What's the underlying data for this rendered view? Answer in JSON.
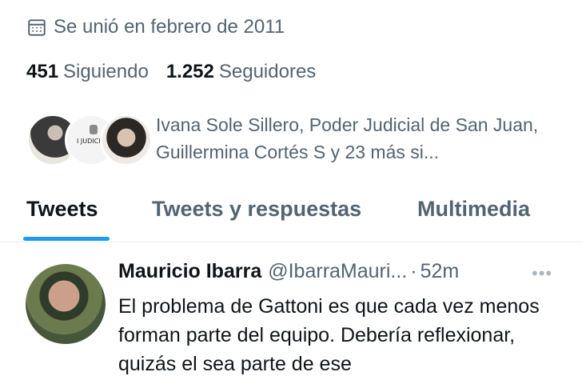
{
  "profile": {
    "joined_text": "Se unió en febrero de 2011",
    "following_count": "451",
    "following_label": "Siguiendo",
    "followers_count": "1.252",
    "followers_label": "Seguidores",
    "followed_by_text": "Ivana Sole Sillero, Poder Judicial de San Juan, Guillermina Cortés S y 23 más si...",
    "followed_avatar_2_text": "I JUDICIAL"
  },
  "tabs": [
    {
      "label": "Tweets",
      "active": true
    },
    {
      "label": "Tweets y respuestas",
      "active": false
    },
    {
      "label": "Multimedia",
      "active": false
    }
  ],
  "tweet": {
    "name": "Mauricio Ibarra",
    "handle": "@IbarraMauri...",
    "separator": "·",
    "time": "52m",
    "more_icon": "more-horizontal-icon",
    "text": "El problema de Gattoni es que cada vez menos forman parte del equipo. Debería reflexionar, quizás el sea parte de ese"
  },
  "colors": {
    "accent": "#1d9bf0",
    "secondary_text": "#536471",
    "primary_text": "#0f1419",
    "divider": "#e6ecf0"
  }
}
